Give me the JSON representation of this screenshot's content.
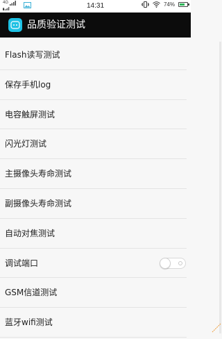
{
  "status_bar": {
    "network_top": "4G",
    "network_bottom": "",
    "time": "14:31",
    "battery_percent": 74,
    "battery_label": "74%",
    "icons": [
      "signal-icon",
      "wifi-icon",
      "vibrate-icon",
      "battery-icon",
      "photo-icon"
    ]
  },
  "app_bar": {
    "title": "品质验证测试",
    "icon": "app-logo-icon",
    "icon_color": "#1ec1e4"
  },
  "items": [
    {
      "label": "Flash读写测试"
    },
    {
      "label": "保存手机log"
    },
    {
      "label": "电容触屏测试"
    },
    {
      "label": "闪光灯测试"
    },
    {
      "label": "主摄像头寿命测试"
    },
    {
      "label": "副摄像头寿命测试"
    },
    {
      "label": "自动对焦测试"
    },
    {
      "label": "调试端口",
      "toggle": {
        "on": false
      }
    },
    {
      "label": "GSM信道测试"
    },
    {
      "label": "蓝牙wifi测试"
    }
  ]
}
